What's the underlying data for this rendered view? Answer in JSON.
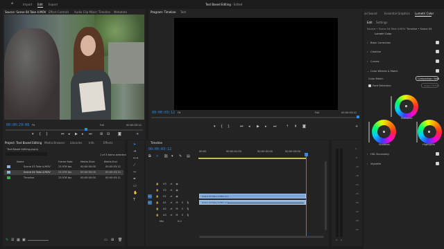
{
  "app": {
    "title": "Text Based Editing",
    "edited": "- Edited",
    "workspace_tabs": [
      {
        "label": "Import",
        "active": false
      },
      {
        "label": "Edit",
        "active": true
      },
      {
        "label": "Export",
        "active": false
      }
    ]
  },
  "source_panel": {
    "tabs": [
      "Source: Scene 04 Take 4.MOV",
      "Effect Controls",
      "Audio Clip Mixer: Timeline",
      "Metadata"
    ],
    "timecode": "00:00:29:08",
    "fit": "Fit",
    "quality": "Full",
    "duration": "00:00:03:12"
  },
  "program_panel": {
    "tabs": [
      "Program: Timeline",
      "Text"
    ],
    "timecode": "00:00:03:12",
    "fit": "Fit",
    "quality": "Full",
    "duration": "00:00:03:12"
  },
  "lumetri": {
    "top_tabs": [
      "ial Sound",
      "Essential Graphics",
      "Lumetri Color"
    ],
    "sub_tabs": [
      "Edit",
      "Settings"
    ],
    "source_label": "Source • Scene 04 Take 4.MOV",
    "target_label": "Timeline • Scene 04",
    "effect_name": "Lumetri Color",
    "sections": [
      "Basic Correction",
      "Creative",
      "Curves",
      "Color Wheels & Match",
      "HSL Secondary",
      "Vignette"
    ],
    "color_match_label": "Color Match",
    "comparison_view_button": "Comparison View",
    "face_detection_label": "Face Detection",
    "apply_match_button": "Apply Match",
    "wheel_labels": [
      "Midtones",
      "Shadows",
      "Highlights"
    ]
  },
  "project_panel": {
    "tabs": [
      "Project: Text Based Editing",
      "Media Browser",
      "Libraries",
      "Info",
      "Effects"
    ],
    "path": "Text Based Editing.prproj",
    "selection_info": "1 of 3 items selected",
    "columns": [
      "Name",
      "Frame Rate",
      "Media Start",
      "Media End"
    ],
    "items": [
      {
        "name": "Scene 03 Take 4.MOV",
        "frame_rate": "23.976 fps",
        "media_start": "00:00:00:00",
        "media_end": "00:00:03:12",
        "color": "#8fb4e4",
        "selected": false
      },
      {
        "name": "Scene 04 Take 4.MOV",
        "frame_rate": "23.976 fps",
        "media_start": "00:00:00:00",
        "media_end": "00:00:03:12",
        "color": "#8fb4e4",
        "selected": true
      },
      {
        "name": "Timeline",
        "frame_rate": "23.976 fps",
        "media_start": "00:00:00:00",
        "media_end": "00:00:03:11",
        "color": "#38b04a",
        "selected": false
      }
    ]
  },
  "timeline_panel": {
    "tab": "Timeline",
    "timecode": "00:00:03:12",
    "ruler_marks": [
      "00:00",
      "00:00:01:00",
      "00:00:02:00",
      "00:00:03:00"
    ],
    "tracks": [
      "V3",
      "V2",
      "V1",
      "A1",
      "A2",
      "A3"
    ],
    "mix_label": "Mix",
    "mix_value": "0.0",
    "clips": [
      {
        "label": "Scene 04 Take 4.MOV [V]",
        "track": "V1"
      },
      {
        "label": "Scene 04 Take 4.MOV [A]",
        "track": "A1"
      }
    ]
  },
  "meters": {
    "db_scale": [
      "0",
      "-6",
      "-12",
      "-18",
      "-24",
      "-30",
      "-36",
      "-42",
      "-48",
      "-54"
    ],
    "bottom": [
      "S",
      "S"
    ]
  }
}
